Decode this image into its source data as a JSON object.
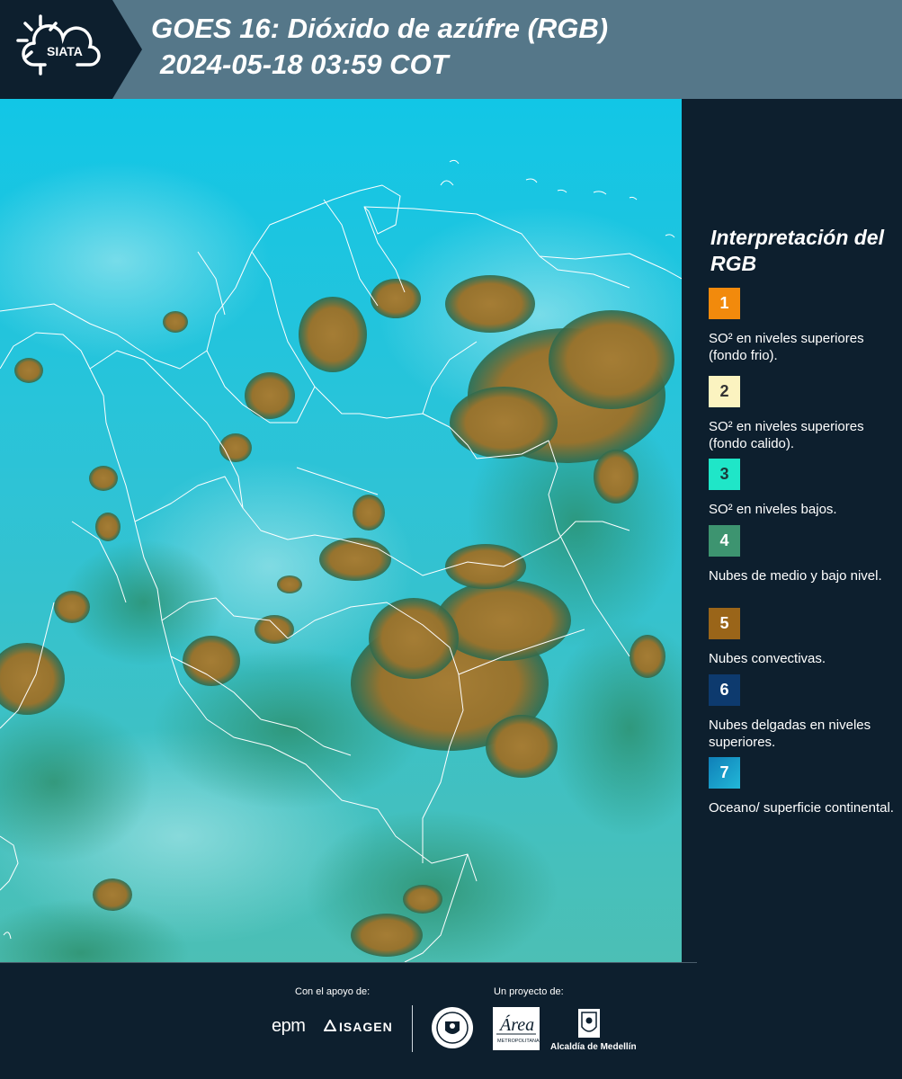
{
  "header": {
    "logo_text": "SIATA",
    "title_line1": "GOES 16: Dióxido de azúfre (RGB)",
    "title_line2": "2024-05-18 03:59 COT",
    "background_color": "#557789"
  },
  "legend": {
    "title": "Interpretación del RGB",
    "items": [
      {
        "number": "1",
        "label": "SO² en niveles superiores (fondo frio).",
        "color": "#f28a0c",
        "text_color": "#ffffff"
      },
      {
        "number": "2",
        "label": "SO² en niveles superiores (fondo calido).",
        "color": "#fbf3c0",
        "text_color": "#333333"
      },
      {
        "number": "3",
        "label": "SO² en niveles bajos.",
        "color": "#1fe6c8",
        "text_color": "#1a3a3a"
      },
      {
        "number": "4",
        "label": "Nubes de medio y bajo nivel.",
        "color": "#3d9470",
        "text_color": "#ffffff"
      },
      {
        "number": "5",
        "label": "Nubes convectivas.",
        "color": "#9a6519",
        "text_color": "#ffffff"
      },
      {
        "number": "6",
        "label": "Nubes delgadas en niveles superiores.",
        "color": "#0d3a6e",
        "text_color": "#ffffff"
      },
      {
        "number": "7",
        "label": "Oceano/ superficie continental.",
        "color": "#1aa3cf",
        "text_color": "#ffffff"
      }
    ]
  },
  "map": {
    "ocean_color": "#27c6d8",
    "land_color": "#2fb5b0",
    "convective_color": "#a27a33",
    "border_color": "#ffffff"
  },
  "footer": {
    "support_label": "Con el apoyo de:",
    "project_label": "Un proyecto de:",
    "logo_epm": "epm",
    "logo_isagen": "ISAGEN",
    "logo_area": "Área",
    "logo_area_sub": "METROPOLITANA",
    "logo_alcaldia": "Alcaldía de Medellín"
  }
}
